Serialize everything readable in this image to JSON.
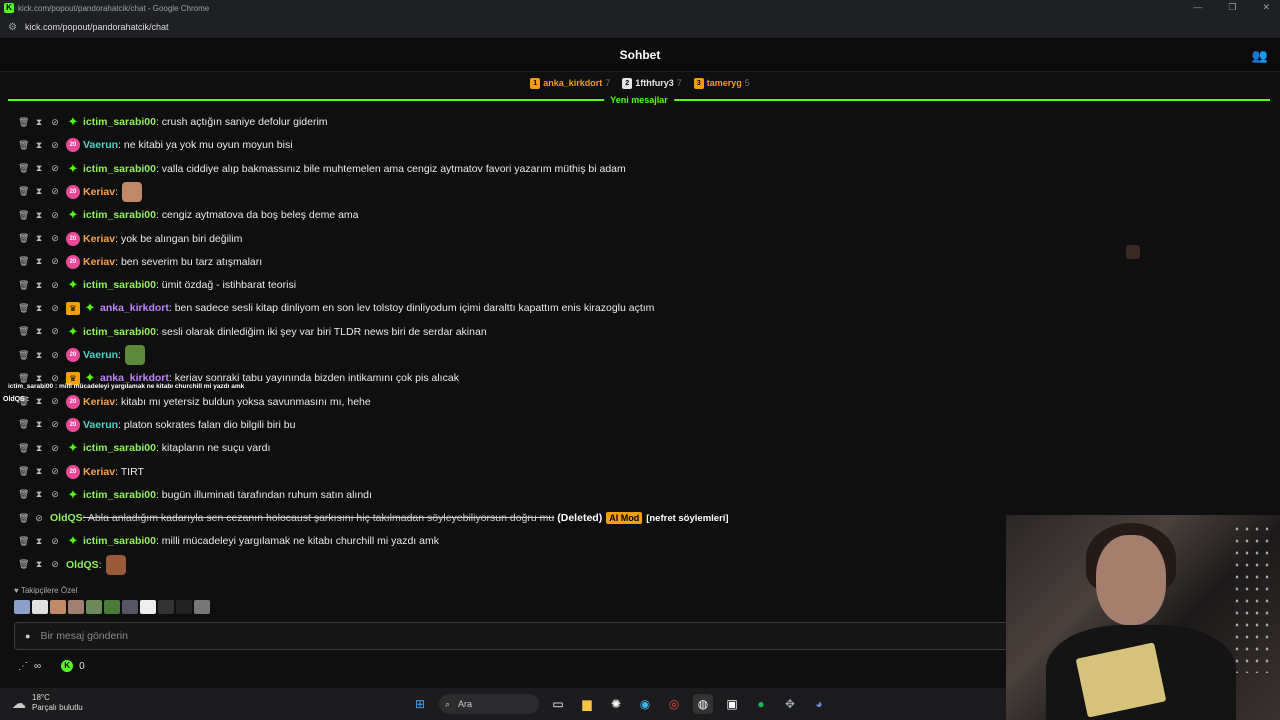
{
  "browser": {
    "window_title": "kick.com/popout/pandorahatcik/chat - Google Chrome",
    "url": "kick.com/popout/pandorahatcik/chat"
  },
  "header": {
    "title": "Sohbet"
  },
  "leaderboard": [
    {
      "name": "anka_kirkdort",
      "count": "7",
      "color": "#f59e0b"
    },
    {
      "name": "1fthfury3",
      "count": "7",
      "color": "#e5e7eb"
    },
    {
      "name": "tameryg",
      "count": "5",
      "color": "#f59e0b"
    }
  ],
  "new_messages_label": "Yeni mesajlar",
  "messages": [
    {
      "user": "ictim_sarabi00",
      "color": "#8ef05a",
      "badge": "star",
      "text": ": crush açtığın saniye defolur giderim"
    },
    {
      "user": "Vaerun",
      "color": "#4fd1c5",
      "badge": "sub",
      "text": ": ne kitabi ya yok mu oyun moyun bisi"
    },
    {
      "user": "ictim_sarabi00",
      "color": "#8ef05a",
      "badge": "star",
      "text": ": valla ciddiye alıp bakmassınız bile muhtemelen ama cengiz aytmatov favori yazarım müthiş bi adam"
    },
    {
      "user": "Keriav",
      "color": "#f6a04d",
      "badge": "sub",
      "text": ":",
      "emote": "#c08a6a"
    },
    {
      "user": "ictim_sarabi00",
      "color": "#8ef05a",
      "badge": "star",
      "text": ": cengiz aytmatova da boş beleş deme ama"
    },
    {
      "user": "Keriav",
      "color": "#f6a04d",
      "badge": "sub",
      "text": ": yok be alıngan biri değilim"
    },
    {
      "user": "Keriav",
      "color": "#f6a04d",
      "badge": "sub",
      "text": ": ben severim bu tarz atışmaları"
    },
    {
      "user": "ictim_sarabi00",
      "color": "#8ef05a",
      "badge": "star",
      "text": ": ümit özdağ - istihbarat teorisi"
    },
    {
      "user": "anka_kirkdort",
      "color": "#c084fc",
      "badge": "crown",
      "text": ": ben sadece sesli kitap dinliyom en son lev tolstoy dinliyodum içimi daralttı kapattım enis kirazoglu açtım"
    },
    {
      "user": "ictim_sarabi00",
      "color": "#8ef05a",
      "badge": "star",
      "text": ": sesli olarak dinlediğim iki şey var biri TLDR news biri de serdar akinan"
    },
    {
      "user": "Vaerun",
      "color": "#4fd1c5",
      "badge": "sub",
      "text": ":",
      "emote": "#5c8a3a"
    },
    {
      "user": "anka_kirkdort",
      "color": "#c084fc",
      "badge": "crown",
      "text": ": keriav sonraki tabu yayınında bizden intikamını çok pis alıcak"
    },
    {
      "user": "Keriav",
      "color": "#f6a04d",
      "badge": "sub",
      "text": ": kitabı mı yetersiz buldun yoksa savunmasını mı, hehe"
    },
    {
      "user": "Vaerun",
      "color": "#4fd1c5",
      "badge": "sub",
      "text": ": platon sokrates falan dio bilgili biri bu"
    },
    {
      "user": "ictim_sarabi00",
      "color": "#8ef05a",
      "badge": "star",
      "text": ": kitapların ne suçu vardı"
    },
    {
      "user": "Keriav",
      "color": "#f6a04d",
      "badge": "sub",
      "text": ": TIRT"
    },
    {
      "user": "ictim_sarabi00",
      "color": "#8ef05a",
      "badge": "star",
      "text": ": bugün illuminati tarafından ruhum satın alındı"
    },
    {
      "user": "OldQS",
      "color": "#8ef05a",
      "badge": "none",
      "text": ": Abla anladığım kadarıyla sen cezanın holocaust şarkısını hiç takılmadan söyleyebiliyorsun doğru mu",
      "deleted": "(Deleted)",
      "aimod": "AI Mod",
      "reason": "[nefret söylemleri]"
    },
    {
      "user": "ictim_sarabi00",
      "color": "#8ef05a",
      "badge": "star",
      "text": ": milli mücadeleyi yargılamak ne kitabı churchill mi yazdı amk"
    },
    {
      "user": "OldQS",
      "color": "#8ef05a",
      "badge": "none",
      "text": ":",
      "emote": "#9a5a3a"
    }
  ],
  "overlay": {
    "line1": "ictim_sarabi00 : milli mücadeleyi yargılamak ne kitabı churchill mi yazdı amk",
    "line2": "OldQS :"
  },
  "followers_only": "Takipçilere Özel",
  "emote_tray_colors": [
    "#8aa0c8",
    "#e0e0e0",
    "#c08a6a",
    "#a08070",
    "#6a8a5a",
    "#4a7a3a",
    "#555566",
    "#eeeeee",
    "#333",
    "#222",
    "#777"
  ],
  "input": {
    "placeholder": "Bir mesaj gönderin"
  },
  "bottom": {
    "infinity": "∞",
    "kick_count": "0"
  },
  "taskbar": {
    "temp": "18°C",
    "weather": "Parçalı bulutlu",
    "search": "Ara"
  }
}
